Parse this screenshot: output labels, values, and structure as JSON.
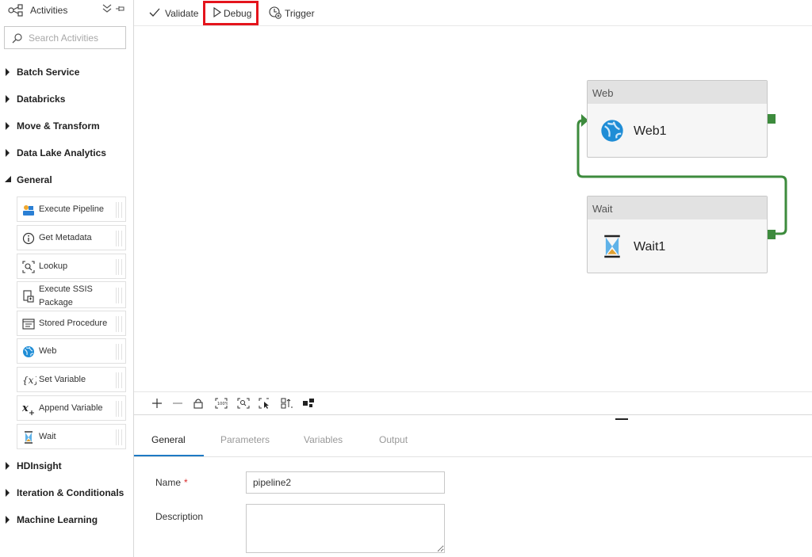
{
  "sidebar": {
    "title": "Activities",
    "search_placeholder": "Search Activities",
    "categories": [
      {
        "label": "Batch Service",
        "expanded": false
      },
      {
        "label": "Databricks",
        "expanded": false
      },
      {
        "label": "Move & Transform",
        "expanded": false
      },
      {
        "label": "Data Lake Analytics",
        "expanded": false
      },
      {
        "label": "General",
        "expanded": true
      },
      {
        "label": "HDInsight",
        "expanded": false
      },
      {
        "label": "Iteration & Conditionals",
        "expanded": false
      },
      {
        "label": "Machine Learning",
        "expanded": false
      }
    ],
    "general_items": [
      {
        "label": "Execute Pipeline",
        "icon": "execute-pipeline-icon"
      },
      {
        "label": "Get Metadata",
        "icon": "info-icon"
      },
      {
        "label": "Lookup",
        "icon": "lookup-icon"
      },
      {
        "label_line1": "Execute SSIS",
        "label_line2": "Package",
        "icon": "ssis-package-icon"
      },
      {
        "label": "Stored Procedure",
        "icon": "stored-procedure-icon"
      },
      {
        "label": "Web",
        "icon": "web-globe-icon"
      },
      {
        "label": "Set Variable",
        "icon": "set-variable-icon"
      },
      {
        "label": "Append Variable",
        "icon": "append-variable-icon"
      },
      {
        "label": "Wait",
        "icon": "hourglass-icon"
      }
    ]
  },
  "toolbar": {
    "validate_label": "Validate",
    "debug_label": "Debug",
    "trigger_label": "Trigger"
  },
  "canvas": {
    "nodes": [
      {
        "type_label": "Web",
        "name": "Web1",
        "icon": "web-globe-icon"
      },
      {
        "type_label": "Wait",
        "name": "Wait1",
        "icon": "hourglass-icon"
      }
    ]
  },
  "properties": {
    "tabs": [
      "General",
      "Parameters",
      "Variables",
      "Output"
    ],
    "active_tab": "General",
    "name_label": "Name",
    "required_mark": "*",
    "name_value": "pipeline2",
    "description_label": "Description",
    "description_value": ""
  },
  "colors": {
    "accent": "#1d7ac4",
    "highlight": "#e4141c",
    "connector_green": "#3d8b3d"
  }
}
